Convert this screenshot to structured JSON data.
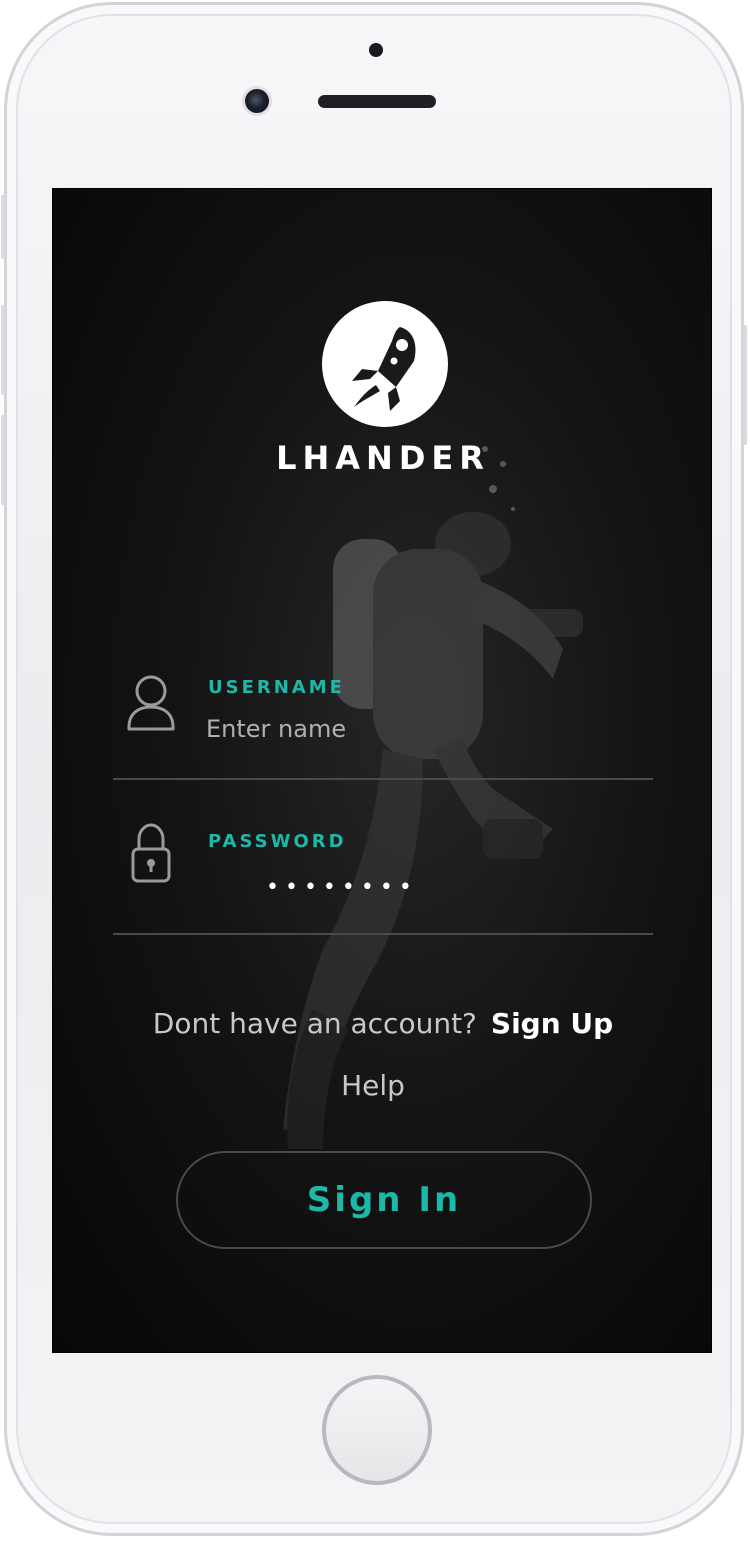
{
  "app": {
    "brand_name": "LHANDER",
    "accent_color": "#1cb8a8",
    "logo_icon": "rocket-icon"
  },
  "form": {
    "username": {
      "label": "USERNAME",
      "placeholder": "Enter name",
      "value": "",
      "icon": "user-icon"
    },
    "password": {
      "label": "PASSWORD",
      "masked_value": "••••••••",
      "icon": "lock-icon"
    }
  },
  "links": {
    "signup_prompt": "Dont have an account?",
    "signup_label": "Sign Up",
    "help_label": "Help"
  },
  "actions": {
    "signin_label": "Sign In"
  }
}
